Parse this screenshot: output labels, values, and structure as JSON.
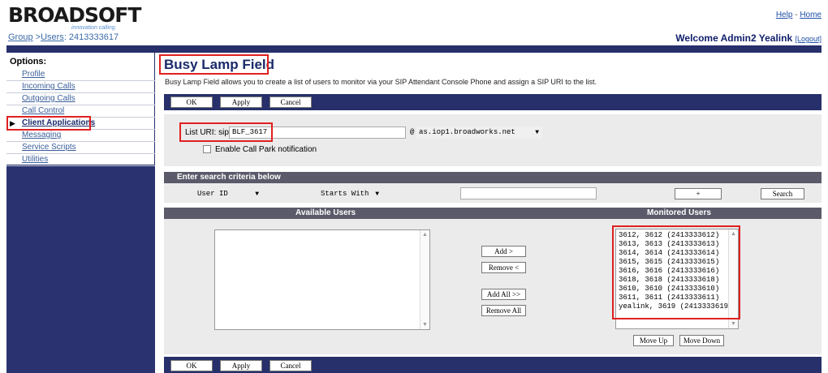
{
  "header": {
    "logo": "BROADSOFT",
    "tagline": "innovation calling.",
    "help_link": "Help",
    "sep": "-",
    "home_link": "Home",
    "crumb_group": "Group",
    "crumb_arrow": ">",
    "crumb_users": "Users",
    "crumb_rest": ": 2413333617",
    "welcome": "Welcome Admin2 Yealink",
    "logout": "[Logout]"
  },
  "sidebar": {
    "heading": "Options:",
    "items": [
      {
        "label": "Profile"
      },
      {
        "label": "Incoming Calls"
      },
      {
        "label": "Outgoing Calls"
      },
      {
        "label": "Call Control"
      },
      {
        "label": "Client Applications"
      },
      {
        "label": "Messaging"
      },
      {
        "label": "Service Scripts"
      },
      {
        "label": "Utilities"
      }
    ]
  },
  "main": {
    "title": "Busy Lamp Field",
    "description": "Busy Lamp Field allows you to create a list of users to monitor via your SIP Attendant Console Phone and assign a SIP URI to the list.",
    "buttons": {
      "ok": "OK",
      "apply": "Apply",
      "cancel": "Cancel"
    },
    "list_uri_label": "List URI: sip:",
    "list_uri_value": "BLF_3617",
    "at": "@",
    "domain": "as.iop1.broadworks.net",
    "call_park_label": "Enable Call Park notification",
    "search_header": "Enter search criteria below",
    "search_field": "User ID",
    "search_mode": "Starts With",
    "search_value": "",
    "plus_button": "+",
    "search_button": "Search",
    "available_header": "Available Users",
    "monitored_header": "Monitored Users",
    "add_button": "Add >",
    "remove_button": "Remove <",
    "add_all_button": "Add All >>",
    "remove_all_button": "Remove All",
    "move_up_button": "Move Up",
    "move_down_button": "Move Down",
    "monitored_users": [
      "3612, 3612 (2413333612)",
      "3613, 3613 (2413333613)",
      "3614, 3614 (2413333614)",
      "3615, 3615 (2413333615)",
      "3616, 3616 (2413333616)",
      "3618, 3618 (2413333618)",
      "3610, 3610 (2413333610)",
      "3611, 3611 (2413333611)",
      "yealink, 3619 (2413333619)"
    ]
  },
  "colors": {
    "navy": "#27306b",
    "highlight": "#e02020"
  }
}
